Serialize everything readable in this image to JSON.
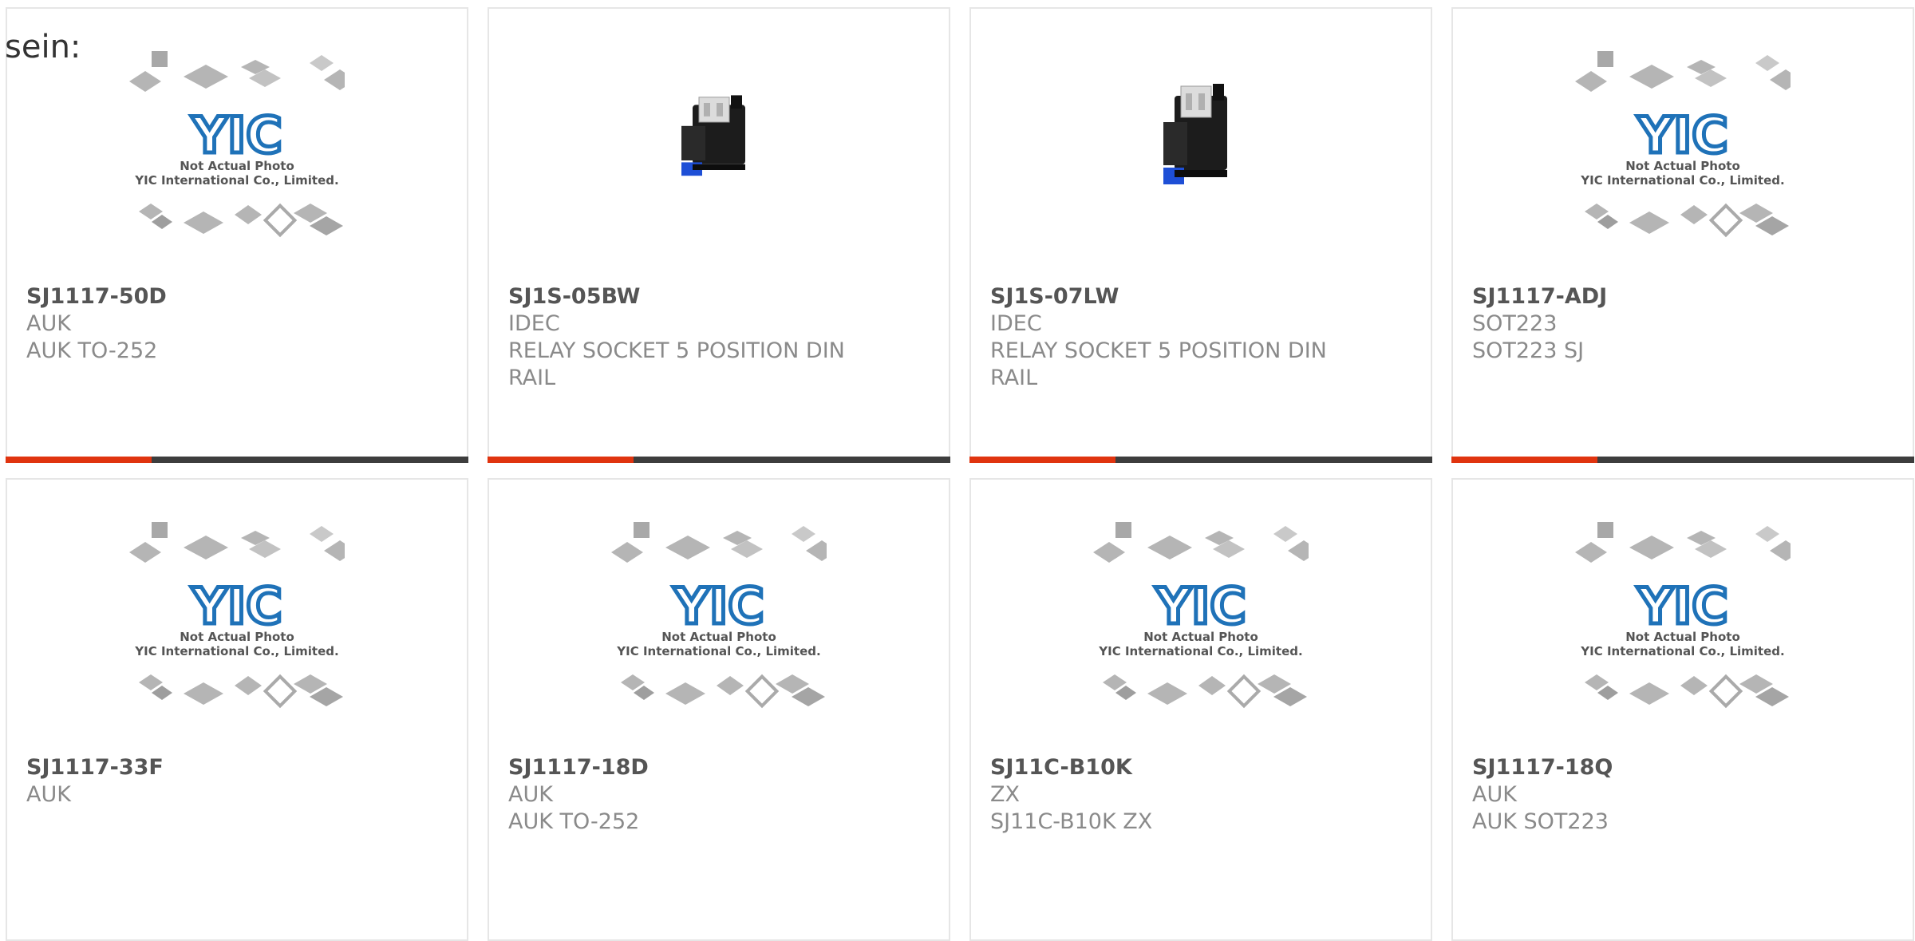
{
  "stray_text": "sein:",
  "placeholder": {
    "brand": "YIC",
    "line1": "Not Actual Photo",
    "line2": "YIC International Co., Limited."
  },
  "colors": {
    "accent": "#e0340f",
    "bar": "#3d3d3d",
    "logo_blue": "#1f72b8",
    "chip_gray": "#b5b5b5"
  },
  "products": [
    {
      "part": "SJ1117-50D",
      "line1": "AUK",
      "line2": "AUK TO-252",
      "line3": "",
      "image": "yic-placeholder-photo"
    },
    {
      "part": "SJ1S-05BW",
      "line1": "IDEC",
      "line2": "RELAY SOCKET 5 POSITION DIN",
      "line3": "RAIL",
      "image": "relay-socket-photo"
    },
    {
      "part": "SJ1S-07LW",
      "line1": "IDEC",
      "line2": "RELAY SOCKET 5 POSITION DIN",
      "line3": "RAIL",
      "image": "relay-socket-photo"
    },
    {
      "part": "SJ1117-ADJ",
      "line1": "SOT223",
      "line2": "SOT223 SJ",
      "line3": "",
      "image": "yic-placeholder-photo"
    },
    {
      "part": "SJ1117-33F",
      "line1": "AUK",
      "line2": "",
      "line3": "",
      "image": "yic-placeholder-photo"
    },
    {
      "part": "SJ1117-18D",
      "line1": "AUK",
      "line2": "AUK TO-252",
      "line3": "",
      "image": "yic-placeholder-photo"
    },
    {
      "part": "SJ11C-B10K",
      "line1": "ZX",
      "line2": "SJ11C-B10K ZX",
      "line3": "",
      "image": "yic-placeholder-photo"
    },
    {
      "part": "SJ1117-18Q",
      "line1": "AUK",
      "line2": "AUK SOT223",
      "line3": "",
      "image": "yic-placeholder-photo"
    }
  ]
}
